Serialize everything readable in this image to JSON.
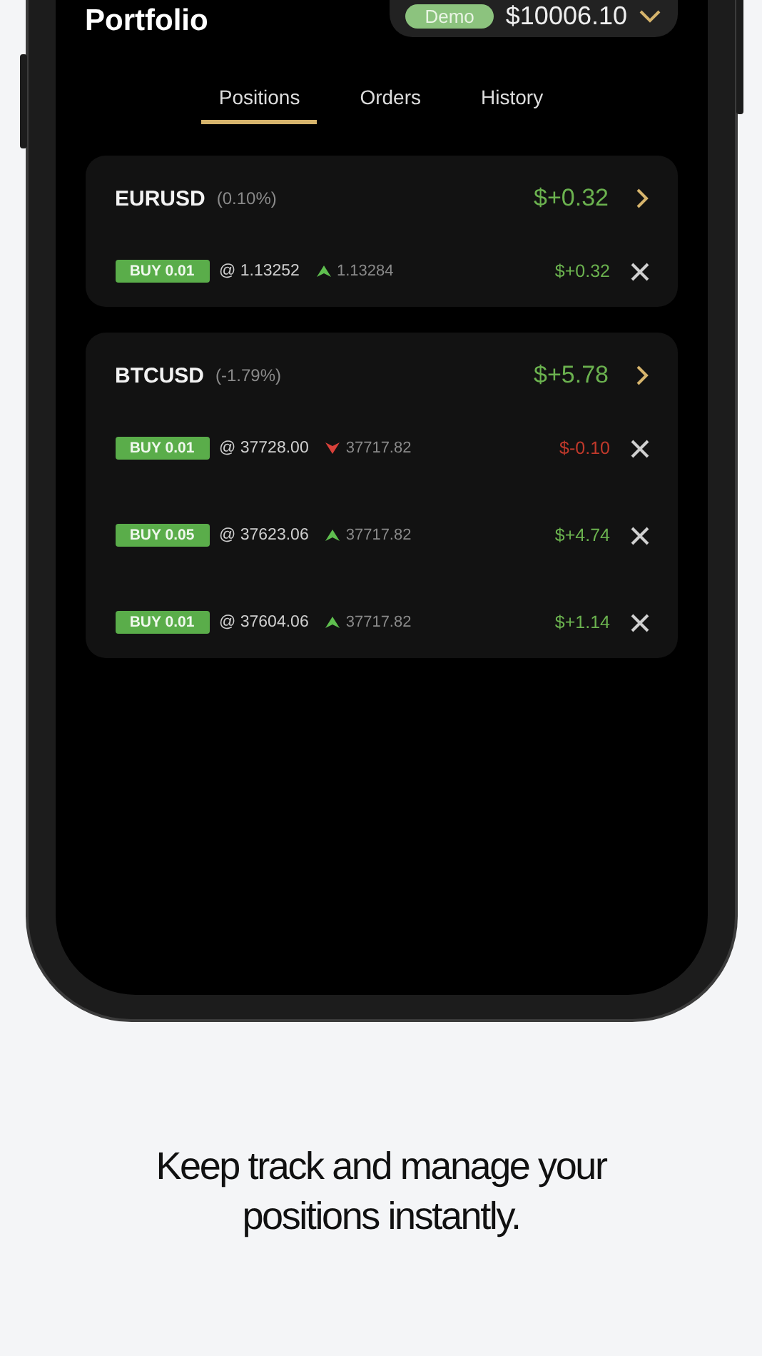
{
  "header": {
    "title": "Portfolio",
    "account_badge": "Demo",
    "balance": "$10006.10"
  },
  "tabs": [
    {
      "label": "Positions",
      "selected": true
    },
    {
      "label": "Orders",
      "selected": false
    },
    {
      "label": "History",
      "selected": false
    }
  ],
  "groups": [
    {
      "symbol": "EURUSD",
      "change": "(0.10%)",
      "total": "$+0.32",
      "loss": false,
      "positions": [
        {
          "side": "BUY 0.01",
          "open": "@ 1.13252",
          "falling": false,
          "current": "1.13284",
          "pnl": "$+0.32",
          "loss": false
        }
      ]
    },
    {
      "symbol": "BTCUSD",
      "change": "(-1.79%)",
      "total": "$+5.78",
      "loss": false,
      "positions": [
        {
          "side": "BUY 0.01",
          "open": "@ 37728.00",
          "falling": true,
          "current": "37717.82",
          "pnl": "$-0.10",
          "loss": true
        },
        {
          "side": "BUY 0.05",
          "open": "@ 37623.06",
          "falling": false,
          "current": "37717.82",
          "pnl": "$+4.74",
          "loss": false
        },
        {
          "side": "BUY 0.01",
          "open": "@ 37604.06",
          "falling": false,
          "current": "37717.82",
          "pnl": "$+1.14",
          "loss": false
        }
      ]
    }
  ],
  "caption": "Keep track and manage your positions instantly."
}
